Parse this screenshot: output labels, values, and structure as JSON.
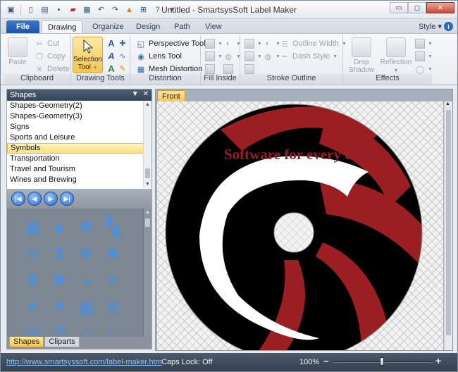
{
  "window": {
    "title": "Untitled - SmartsysSoft Label Maker",
    "controls": {
      "minimize": "▭",
      "maximize": "◻",
      "close": "✕"
    }
  },
  "quick_access": [
    "new-icon",
    "open-icon",
    "save-icon",
    "pdf-icon",
    "print-icon",
    "undo-icon",
    "redo-icon",
    "cart-icon",
    "help-icon"
  ],
  "ribbon_tabs": {
    "file": "File",
    "tabs": [
      "Drawing",
      "Organize",
      "Design",
      "Path",
      "View"
    ],
    "active": "Drawing",
    "style_label": "Style",
    "style_arrow": "▾",
    "help": "i"
  },
  "clipboard": {
    "paste": "Paste",
    "cut": "Cut",
    "copy": "Copy",
    "delete": "Delete",
    "label": "Clipboard"
  },
  "drawing_tools": {
    "selection_line1": "Selection",
    "selection_line2": "Tool",
    "label": "Drawing Tools"
  },
  "distortion": {
    "perspective": "Perspective Tool",
    "lens": "Lens Tool",
    "mesh": "Mesh Distortion",
    "label": "Distortion"
  },
  "fill_inside": {
    "label": "Fill Inside"
  },
  "stroke_outline": {
    "outline_width": "Outline Width",
    "dash_style": "Dash Style",
    "label": "Stroke Outline"
  },
  "effects": {
    "drop_line1": "Drop",
    "drop_line2": "Shadow",
    "reflection": "Reflection",
    "label": "Effects"
  },
  "shapes_panel": {
    "title": "Shapes",
    "categories": [
      "Shapes-Geometry(2)",
      "Shapes-Geometry(3)",
      "Signs",
      "Sports and Leisure",
      "Symbols",
      "Transportation",
      "Travel and Tourism",
      "Wines and Brewing"
    ],
    "selected": "Symbols",
    "nav": [
      "first",
      "prev",
      "next",
      "last"
    ],
    "tabs": [
      "Shapes",
      "Cliparts"
    ],
    "active_tab": "Shapes"
  },
  "symbols": [
    "image-icon",
    "mountain-icon",
    "gear-icon",
    "flag-icon",
    "biohazard-icon",
    "hourglass-icon",
    "diamond-dots-icon",
    "sunburst-icon",
    "fist-icon",
    "starburst-icon",
    "ball-icon",
    "cross-swords-icon",
    "bat-icon",
    "award-icon",
    "checker-icon",
    "radiation-icon",
    "tanks-icon",
    "microscope-icon",
    "triangle-icon",
    "moon-icon"
  ],
  "document": {
    "tab": "Front",
    "disc_text": "Software for every day",
    "colors": {
      "black": "#000000",
      "red": "#9a1e22",
      "white": "#ffffff",
      "text": "#9a1e2a"
    }
  },
  "status": {
    "link": "http://www.smartsyssoft.com/label-maker.htm",
    "caps": "Caps Lock: Off",
    "zoom": "100%",
    "zoom_minus": "−",
    "zoom_plus": "+",
    "zoom_level": 100
  }
}
